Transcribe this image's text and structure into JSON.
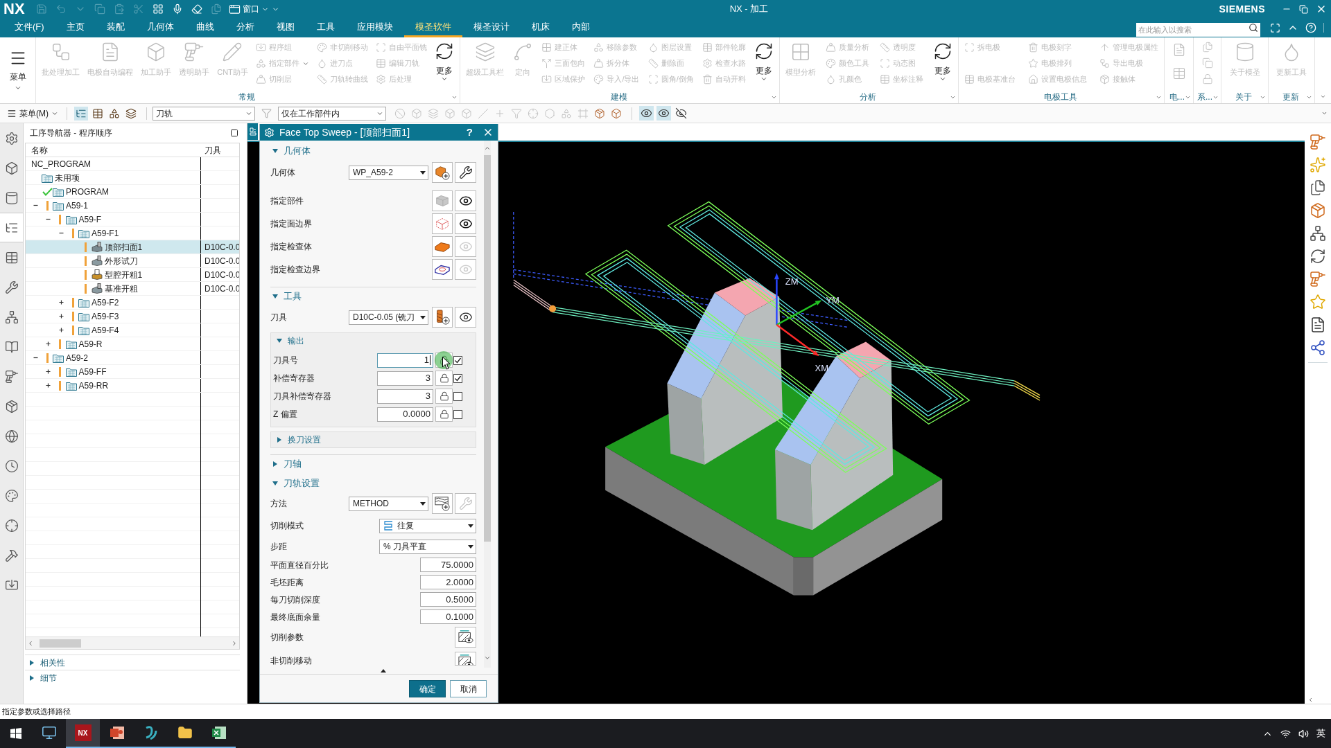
{
  "title_bar": {
    "logo": "NX",
    "quick_access": [
      {
        "disabled": true
      },
      {
        "disabled": true
      },
      {
        "disabled": true
      },
      {
        "disabled": true
      },
      {
        "disabled": true
      },
      {
        "disabled": true
      },
      {
        "disabled": false
      },
      {
        "disabled": false
      },
      {
        "disabled": false
      },
      {
        "disabled": true
      }
    ],
    "window_menu": "窗口",
    "title": "NX - 加工",
    "brand": "SIEMENS"
  },
  "menu_tabs": [
    {
      "label": "文件(F)",
      "selected": false
    },
    {
      "label": "主页",
      "selected": false
    },
    {
      "label": "装配",
      "selected": false
    },
    {
      "label": "几何体",
      "selected": false
    },
    {
      "label": "曲线",
      "selected": false
    },
    {
      "label": "分析",
      "selected": false
    },
    {
      "label": "视图",
      "selected": false
    },
    {
      "label": "工具",
      "selected": false
    },
    {
      "label": "应用模块",
      "selected": false
    },
    {
      "label": "模圣软件",
      "selected": true
    },
    {
      "label": "模圣设计",
      "selected": false
    },
    {
      "label": "机床",
      "selected": false
    },
    {
      "label": "内部",
      "selected": false
    }
  ],
  "search": {
    "placeholder": "在此输入以搜索"
  },
  "ribbon": {
    "menu_button": "菜单",
    "groups": [
      {
        "title": "常规",
        "columns": [
          {
            "kind": "large",
            "label": "批处理加工",
            "disabled": true
          },
          {
            "kind": "large",
            "label": "电极自动编程",
            "disabled": true
          },
          {
            "kind": "large",
            "label": "加工助手",
            "disabled": true
          },
          {
            "kind": "large",
            "label": "透明助手",
            "disabled": true
          },
          {
            "kind": "large",
            "label": "CNT助手",
            "disabled": true
          },
          {
            "kind": "small",
            "items": [
              {
                "label": "程序组",
                "disabled": true
              },
              {
                "label": "指定部件",
                "disabled": true,
                "has_menu": true
              },
              {
                "label": "切削层",
                "disabled": true
              }
            ]
          },
          {
            "kind": "small",
            "items": [
              {
                "label": "非切削移动",
                "disabled": true
              },
              {
                "label": "进刀点",
                "disabled": true
              },
              {
                "label": "刀轨转曲线",
                "disabled": true
              }
            ]
          },
          {
            "kind": "small",
            "items": [
              {
                "label": "自由平面铣",
                "disabled": true
              },
              {
                "label": "编辑刀轨",
                "disabled": true
              },
              {
                "label": "后处理",
                "disabled": true
              }
            ]
          },
          {
            "kind": "more",
            "label": "更多",
            "disabled": false
          }
        ]
      },
      {
        "title": "建模",
        "columns": [
          {
            "kind": "large",
            "label": "超级工具栏",
            "disabled": true
          },
          {
            "kind": "large",
            "label": "定向",
            "disabled": true
          },
          {
            "kind": "small",
            "items": [
              {
                "label": "建正体",
                "disabled": true
              },
              {
                "label": "三面包向",
                "disabled": true
              },
              {
                "label": "区域保护",
                "disabled": true
              }
            ]
          },
          {
            "kind": "small",
            "items": [
              {
                "label": "移除参数",
                "disabled": true
              },
              {
                "label": "拆分体",
                "disabled": true
              },
              {
                "label": "导入/导出",
                "disabled": true
              }
            ]
          },
          {
            "kind": "small",
            "items": [
              {
                "label": "图层设置",
                "disabled": true
              },
              {
                "label": "删除面",
                "disabled": true
              },
              {
                "label": "圆角/倒角",
                "disabled": true
              }
            ]
          },
          {
            "kind": "small",
            "items": [
              {
                "label": "部件轮廓",
                "disabled": true
              },
              {
                "label": "检查水路",
                "disabled": true
              },
              {
                "label": "自动开料",
                "disabled": true
              }
            ]
          },
          {
            "kind": "more",
            "label": "更多",
            "disabled": false
          }
        ]
      },
      {
        "title": "分析",
        "columns": [
          {
            "kind": "large",
            "label": "模型分析",
            "disabled": true
          },
          {
            "kind": "small",
            "items": [
              {
                "label": "质量分析",
                "disabled": true
              },
              {
                "label": "颜色工具",
                "disabled": true
              },
              {
                "label": "孔颜色",
                "disabled": true
              }
            ]
          },
          {
            "kind": "small",
            "items": [
              {
                "label": "透明度",
                "disabled": true
              },
              {
                "label": "动态图",
                "disabled": true
              },
              {
                "label": "坐标注释",
                "disabled": true
              }
            ]
          },
          {
            "kind": "more",
            "label": "更多",
            "disabled": false
          }
        ]
      },
      {
        "title": "电极工具",
        "columns": [
          {
            "kind": "small",
            "items": [
              {
                "label": "拆电极",
                "disabled": true
              },
              {
                "label": "电极基准台",
                "disabled": true
              }
            ]
          },
          {
            "kind": "small",
            "items": [
              {
                "label": "电极刻字",
                "disabled": true
              },
              {
                "label": "电极排列",
                "disabled": true
              },
              {
                "label": "设置电极信息",
                "disabled": true
              }
            ]
          },
          {
            "kind": "small",
            "items": [
              {
                "label": "管理电极属性",
                "disabled": true
              },
              {
                "label": "导出电极",
                "disabled": true
              },
              {
                "label": "接触体",
                "disabled": true
              }
            ]
          }
        ]
      },
      {
        "title": "电...",
        "columns": [
          {
            "kind": "icon_pair"
          }
        ]
      },
      {
        "title": "系...",
        "columns": [
          {
            "kind": "icon_trio"
          }
        ]
      },
      {
        "title": "关于",
        "columns": [
          {
            "kind": "large",
            "label": "关于模圣",
            "disabled": true
          }
        ]
      },
      {
        "title": "更新",
        "columns": [
          {
            "kind": "large",
            "label": "更新工具",
            "disabled": true
          }
        ]
      }
    ]
  },
  "toolbar": {
    "menu": "菜单(M)",
    "views": [
      {
        "selected": true
      },
      {
        "selected": false
      },
      {
        "selected": false
      },
      {
        "selected": false
      }
    ],
    "type_filter": "刀轨",
    "scope_filter": "仅在工作部件内",
    "select_tools": [
      {
        "disabled": true
      },
      {
        "disabled": true
      },
      {
        "disabled": true
      },
      {
        "disabled": true
      },
      {
        "disabled": true
      },
      {
        "disabled": true
      },
      {
        "disabled": true
      },
      {
        "disabled": true
      },
      {
        "disabled": true
      },
      {
        "disabled": true
      },
      {
        "disabled": true
      },
      {
        "disabled": true
      },
      {
        "disabled": false
      },
      {
        "disabled": false
      }
    ],
    "display_tools": [
      {
        "on": true
      },
      {
        "on": true
      },
      {
        "on": false
      }
    ]
  },
  "resource_bar": [
    {
      "selected": false
    },
    {
      "selected": false
    },
    {
      "selected": false
    },
    {
      "selected": true
    },
    {
      "selected": false
    },
    {
      "selected": false
    },
    {
      "selected": false
    },
    {
      "selected": false
    },
    {
      "selected": false
    },
    {
      "selected": false
    },
    {
      "selected": false
    },
    {
      "selected": false
    },
    {
      "selected": false
    },
    {
      "selected": false
    },
    {
      "selected": false
    },
    {
      "selected": false
    }
  ],
  "navigator": {
    "title": "工序导航器 - 程序顺序",
    "columns": [
      "名称",
      "刀具"
    ],
    "tree": [
      {
        "name": "NC_PROGRAM",
        "kind": "root",
        "complete": false,
        "outdated": false,
        "selected": false,
        "children": [
          {
            "name": "未用项",
            "kind": "folder",
            "complete": false,
            "outdated": false,
            "selected": false
          },
          {
            "name": "PROGRAM",
            "kind": "folder",
            "complete": true,
            "outdated": false,
            "selected": false
          },
          {
            "name": "A59-1",
            "kind": "folder",
            "complete": false,
            "outdated": true,
            "expanded": true,
            "selected": false,
            "children": [
              {
                "name": "A59-F",
                "kind": "folder",
                "complete": false,
                "outdated": true,
                "expanded": true,
                "selected": false,
                "children": [
                  {
                    "name": "A59-F1",
                    "kind": "folder",
                    "complete": false,
                    "outdated": true,
                    "expanded": true,
                    "selected": false,
                    "children": [
                      {
                        "name": "顶部扫面1",
                        "kind": "face_mill",
                        "complete": false,
                        "outdated": true,
                        "tool": "D10C-0.0",
                        "selected": true
                      },
                      {
                        "name": "外形试刀",
                        "kind": "contour_mill",
                        "complete": false,
                        "outdated": true,
                        "tool": "D10C-0.0",
                        "selected": false
                      },
                      {
                        "name": "型腔开粗1",
                        "kind": "cavity_mill",
                        "complete": false,
                        "outdated": true,
                        "tool": "D10C-0.0",
                        "selected": false
                      },
                      {
                        "name": "基准开粗",
                        "kind": "contour_mill",
                        "complete": false,
                        "outdated": true,
                        "tool": "D10C-0.0",
                        "selected": false
                      }
                    ]
                  },
                  {
                    "name": "A59-F2",
                    "kind": "folder",
                    "complete": false,
                    "outdated": true,
                    "expanded": false,
                    "selected": false
                  },
                  {
                    "name": "A59-F3",
                    "kind": "folder",
                    "complete": false,
                    "outdated": true,
                    "expanded": false,
                    "selected": false
                  },
                  {
                    "name": "A59-F4",
                    "kind": "folder",
                    "complete": false,
                    "outdated": true,
                    "expanded": false,
                    "selected": false
                  }
                ]
              },
              {
                "name": "A59-R",
                "kind": "folder",
                "complete": false,
                "outdated": true,
                "expanded": false,
                "selected": false
              }
            ]
          },
          {
            "name": "A59-2",
            "kind": "folder",
            "complete": false,
            "outdated": true,
            "expanded": true,
            "selected": false,
            "children": [
              {
                "name": "A59-FF",
                "kind": "folder",
                "complete": false,
                "outdated": true,
                "expanded": false,
                "selected": false
              },
              {
                "name": "A59-RR",
                "kind": "folder",
                "complete": false,
                "outdated": true,
                "expanded": false,
                "selected": false
              }
            ]
          }
        ]
      }
    ],
    "sections": [
      {
        "label": "相关性",
        "expanded": false
      },
      {
        "label": "细节",
        "expanded": false
      }
    ]
  },
  "dialog": {
    "title": "Face Top Sweep - [顶部扫面1]",
    "help": "?",
    "sections": [
      {
        "title": "几何体",
        "expanded": true,
        "rows": [
          {
            "kind": "geometry",
            "label": "几何体",
            "value": "WP_A59-2",
            "edit_enabled": true
          },
          {
            "kind": "part",
            "label": "指定部件",
            "select_enabled": false,
            "display_enabled": true
          },
          {
            "kind": "face_boundary",
            "label": "指定面边界",
            "select_enabled": true,
            "display_enabled": true
          },
          {
            "kind": "check_body",
            "label": "指定检查体",
            "select_enabled": true,
            "display_enabled": false
          },
          {
            "kind": "check_boundary",
            "label": "指定检查边界",
            "select_enabled": true,
            "display_enabled": false
          }
        ]
      },
      {
        "title": "工具",
        "expanded": true,
        "rows": [
          {
            "kind": "tool",
            "label": "刀具",
            "value": "D10C-0.05 (铣刀",
            "edit_enabled": true
          }
        ],
        "subsections": [
          {
            "title": "输出",
            "expanded": true,
            "rows": [
              {
                "label": "刀具号",
                "value": "1",
                "checked": true,
                "focused": true
              },
              {
                "label": "补偿寄存器",
                "value": "3",
                "checked": true,
                "focused": false
              },
              {
                "label": "刀具补偿寄存器",
                "value": "3",
                "checked": false,
                "focused": false
              },
              {
                "label": "Z 偏置",
                "value": "0.0000",
                "checked": false,
                "focused": false
              }
            ]
          },
          {
            "title": "换刀设置",
            "expanded": false
          }
        ]
      },
      {
        "title": "刀轴",
        "expanded": false
      },
      {
        "title": "刀轨设置",
        "expanded": true,
        "rows": [
          {
            "kind": "method",
            "label": "方法",
            "value": "METHOD",
            "edit_enabled": false
          },
          {
            "kind": "cut_pattern",
            "label": "切削模式",
            "value": "往复"
          },
          {
            "kind": "choice",
            "label": "步距",
            "value": "% 刀具平直"
          },
          {
            "kind": "number",
            "label": "平面直径百分比",
            "value": "75.0000"
          },
          {
            "kind": "number",
            "label": "毛坯距离",
            "value": "2.0000"
          },
          {
            "kind": "number",
            "label": "每刀切削深度",
            "value": "0.5000"
          },
          {
            "kind": "number",
            "label": "最终底面余量",
            "value": "0.1000"
          },
          {
            "kind": "dialog_button",
            "label": "切削参数"
          },
          {
            "kind": "dialog_button",
            "label": "非切削移动"
          }
        ]
      }
    ],
    "buttons": [
      {
        "label": "确定",
        "kind": "primary"
      },
      {
        "label": "取消",
        "kind": "secondary"
      }
    ]
  },
  "viewport": {
    "axes": [
      {
        "label": "ZM"
      },
      {
        "label": "YM"
      },
      {
        "label": "XM"
      }
    ]
  },
  "status_bar": {
    "prompt": "指定参数或选择路径"
  },
  "taskbar": {
    "apps": [
      {
        "kind": "desktop",
        "running": false,
        "active": false
      },
      {
        "kind": "nx",
        "label": "NX",
        "running": true,
        "active": true
      },
      {
        "kind": "presentation",
        "running": true,
        "active": false
      },
      {
        "kind": "s_app",
        "running": true,
        "active": false
      },
      {
        "kind": "explorer",
        "running": true,
        "active": false
      },
      {
        "kind": "spreadsheet",
        "running": true,
        "active": false
      }
    ],
    "ime": "英"
  }
}
